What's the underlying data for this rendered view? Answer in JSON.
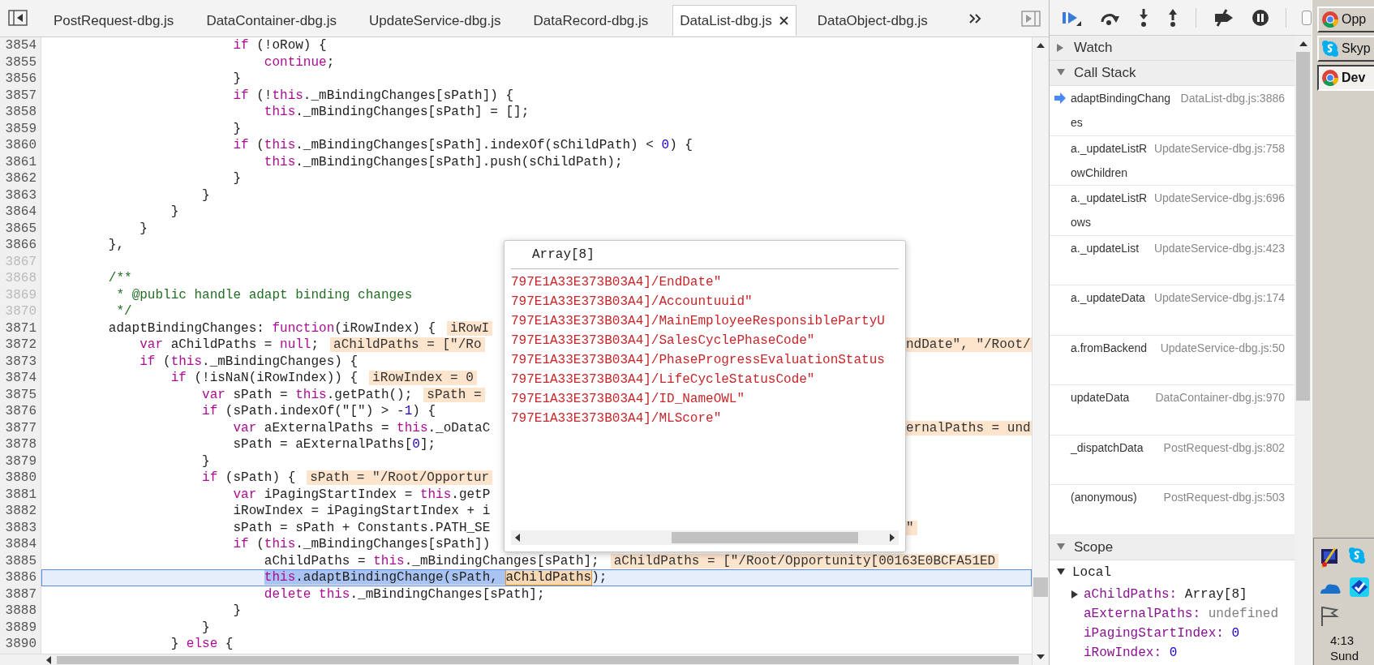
{
  "editor": {
    "tabs": [
      {
        "label": "PostRequest-dbg.js",
        "selected": false
      },
      {
        "label": "DataContainer-dbg.js",
        "selected": false
      },
      {
        "label": "UpdateService-dbg.js",
        "selected": false
      },
      {
        "label": "DataRecord-dbg.js",
        "selected": false
      },
      {
        "label": "DataList-dbg.js",
        "selected": true
      },
      {
        "label": "DataObject-dbg.js",
        "selected": false
      }
    ],
    "lines": [
      {
        "number": "3854",
        "executable": true,
        "current": false,
        "code": [
          {
            "kind": "code",
            "tokens": [
              {
                "kind": "keyword",
                "text": "                        if"
              },
              {
                "kind": "plain",
                "text": " (!oRow) {"
              }
            ]
          }
        ]
      },
      {
        "number": "3855",
        "executable": true,
        "current": false,
        "code": [
          {
            "kind": "code",
            "tokens": [
              {
                "kind": "keyword",
                "text": "                            continue"
              },
              {
                "kind": "plain",
                "text": ";"
              }
            ]
          }
        ]
      },
      {
        "number": "3856",
        "executable": true,
        "current": false,
        "code": [
          {
            "kind": "code",
            "tokens": [
              {
                "kind": "plain",
                "text": "                        }"
              }
            ]
          }
        ]
      },
      {
        "number": "3857",
        "executable": true,
        "current": false,
        "code": [
          {
            "kind": "code",
            "tokens": [
              {
                "kind": "keyword",
                "text": "                        if"
              },
              {
                "kind": "plain",
                "text": " (!"
              },
              {
                "kind": "keyword",
                "text": "this"
              },
              {
                "kind": "plain",
                "text": "._mBindingChanges[sPath]) {"
              }
            ]
          }
        ]
      },
      {
        "number": "3858",
        "executable": true,
        "current": false,
        "code": [
          {
            "kind": "code",
            "tokens": [
              {
                "kind": "keyword",
                "text": "                            this"
              },
              {
                "kind": "plain",
                "text": "._mBindingChanges[sPath] = [];"
              }
            ]
          }
        ]
      },
      {
        "number": "3859",
        "executable": true,
        "current": false,
        "code": [
          {
            "kind": "code",
            "tokens": [
              {
                "kind": "plain",
                "text": "                        }"
              }
            ]
          }
        ]
      },
      {
        "number": "3860",
        "executable": true,
        "current": false,
        "code": [
          {
            "kind": "code",
            "tokens": [
              {
                "kind": "keyword",
                "text": "                        if"
              },
              {
                "kind": "plain",
                "text": " ("
              },
              {
                "kind": "keyword",
                "text": "this"
              },
              {
                "kind": "plain",
                "text": "._mBindingChanges[sPath].indexOf(sChildPath) < "
              },
              {
                "kind": "number",
                "text": "0"
              },
              {
                "kind": "plain",
                "text": ") {"
              }
            ]
          }
        ]
      },
      {
        "number": "3861",
        "executable": true,
        "current": false,
        "code": [
          {
            "kind": "code",
            "tokens": [
              {
                "kind": "keyword",
                "text": "                            this"
              },
              {
                "kind": "plain",
                "text": "._mBindingChanges[sPath].push(sChildPath);"
              }
            ]
          }
        ]
      },
      {
        "number": "3862",
        "executable": true,
        "current": false,
        "code": [
          {
            "kind": "code",
            "tokens": [
              {
                "kind": "plain",
                "text": "                        }"
              }
            ]
          }
        ]
      },
      {
        "number": "3863",
        "executable": true,
        "current": false,
        "code": [
          {
            "kind": "code",
            "tokens": [
              {
                "kind": "plain",
                "text": "                    }"
              }
            ]
          }
        ]
      },
      {
        "number": "3864",
        "executable": true,
        "current": false,
        "code": [
          {
            "kind": "code",
            "tokens": [
              {
                "kind": "plain",
                "text": "                }"
              }
            ]
          }
        ]
      },
      {
        "number": "3865",
        "executable": true,
        "current": false,
        "code": [
          {
            "kind": "code",
            "tokens": [
              {
                "kind": "plain",
                "text": "            }"
              }
            ]
          }
        ]
      },
      {
        "number": "3866",
        "executable": true,
        "current": false,
        "code": [
          {
            "kind": "code",
            "tokens": [
              {
                "kind": "plain",
                "text": "        },"
              }
            ]
          }
        ]
      },
      {
        "number": "3867",
        "executable": false,
        "current": false
      },
      {
        "number": "3868",
        "executable": false,
        "current": false,
        "code": [
          {
            "kind": "code",
            "tokens": [
              {
                "kind": "comment",
                "text": "        /**"
              }
            ]
          }
        ]
      },
      {
        "number": "3869",
        "executable": false,
        "current": false,
        "code": [
          {
            "kind": "code",
            "tokens": [
              {
                "kind": "comment",
                "text": "         * @public handle adapt binding changes"
              }
            ]
          }
        ]
      },
      {
        "number": "3870",
        "executable": false,
        "current": false,
        "code": [
          {
            "kind": "code",
            "tokens": [
              {
                "kind": "comment",
                "text": "         */"
              }
            ]
          }
        ]
      },
      {
        "number": "3871",
        "executable": true,
        "current": false,
        "code": [
          {
            "kind": "code",
            "tokens": [
              {
                "kind": "plain",
                "text": "        adaptBindingChanges: "
              },
              {
                "kind": "keyword",
                "text": "function"
              },
              {
                "kind": "plain",
                "text": "(iRowIndex) {"
              }
            ]
          },
          {
            "kind": "value",
            "text": "iRowI"
          }
        ]
      },
      {
        "number": "3872",
        "executable": true,
        "current": false,
        "code": [
          {
            "kind": "code",
            "tokens": [
              {
                "kind": "keyword",
                "text": "            var"
              },
              {
                "kind": "plain",
                "text": " aChildPaths = "
              },
              {
                "kind": "keyword",
                "text": "null"
              },
              {
                "kind": "plain",
                "text": ";"
              }
            ]
          },
          {
            "kind": "value",
            "text": "aChildPaths = [\"/Ro"
          }
        ],
        "tail": [
          {
            "kind": "value",
            "text": "ndDate\", \"/Root/"
          }
        ]
      },
      {
        "number": "3873",
        "executable": true,
        "current": false,
        "code": [
          {
            "kind": "code",
            "tokens": [
              {
                "kind": "keyword",
                "text": "            if"
              },
              {
                "kind": "plain",
                "text": " ("
              },
              {
                "kind": "keyword",
                "text": "this"
              },
              {
                "kind": "plain",
                "text": "._mBindingChanges) {"
              }
            ]
          }
        ]
      },
      {
        "number": "3874",
        "executable": true,
        "current": false,
        "code": [
          {
            "kind": "code",
            "tokens": [
              {
                "kind": "keyword",
                "text": "                if"
              },
              {
                "kind": "plain",
                "text": " (!isNaN(iRowIndex)) {"
              }
            ]
          },
          {
            "kind": "value",
            "text": "iRowIndex = 0"
          }
        ]
      },
      {
        "number": "3875",
        "executable": true,
        "current": false,
        "code": [
          {
            "kind": "code",
            "tokens": [
              {
                "kind": "keyword",
                "text": "                    var"
              },
              {
                "kind": "plain",
                "text": " sPath = "
              },
              {
                "kind": "keyword",
                "text": "this"
              },
              {
                "kind": "plain",
                "text": ".getPath();"
              }
            ]
          },
          {
            "kind": "value",
            "text": "sPath ="
          }
        ]
      },
      {
        "number": "3876",
        "executable": true,
        "current": false,
        "code": [
          {
            "kind": "code",
            "tokens": [
              {
                "kind": "keyword",
                "text": "                    if"
              },
              {
                "kind": "plain",
                "text": " (sPath.indexOf(\"[\") > -"
              },
              {
                "kind": "number",
                "text": "1"
              },
              {
                "kind": "plain",
                "text": ") {"
              }
            ]
          }
        ]
      },
      {
        "number": "3877",
        "executable": true,
        "current": false,
        "code": [
          {
            "kind": "code",
            "tokens": [
              {
                "kind": "keyword",
                "text": "                        var"
              },
              {
                "kind": "plain",
                "text": " aExternalPaths = "
              },
              {
                "kind": "keyword",
                "text": "this"
              },
              {
                "kind": "plain",
                "text": "._oDataC"
              }
            ]
          }
        ],
        "tail": [
          {
            "kind": "value",
            "text": "ernalPaths = und"
          }
        ]
      },
      {
        "number": "3878",
        "executable": true,
        "current": false,
        "code": [
          {
            "kind": "code",
            "tokens": [
              {
                "kind": "plain",
                "text": "                        sPath = aExternalPaths["
              },
              {
                "kind": "number",
                "text": "0"
              },
              {
                "kind": "plain",
                "text": "];"
              }
            ]
          }
        ]
      },
      {
        "number": "3879",
        "executable": true,
        "current": false,
        "code": [
          {
            "kind": "code",
            "tokens": [
              {
                "kind": "plain",
                "text": "                    }"
              }
            ]
          }
        ]
      },
      {
        "number": "3880",
        "executable": true,
        "current": false,
        "code": [
          {
            "kind": "code",
            "tokens": [
              {
                "kind": "keyword",
                "text": "                    if"
              },
              {
                "kind": "plain",
                "text": " (sPath) {"
              }
            ]
          },
          {
            "kind": "value",
            "text": "sPath = \"/Root/Opportur"
          }
        ]
      },
      {
        "number": "3881",
        "executable": true,
        "current": false,
        "code": [
          {
            "kind": "code",
            "tokens": [
              {
                "kind": "keyword",
                "text": "                        var"
              },
              {
                "kind": "plain",
                "text": " iPagingStartIndex = "
              },
              {
                "kind": "keyword",
                "text": "this"
              },
              {
                "kind": "plain",
                "text": ".getP"
              }
            ]
          }
        ]
      },
      {
        "number": "3882",
        "executable": true,
        "current": false,
        "code": [
          {
            "kind": "code",
            "tokens": [
              {
                "kind": "plain",
                "text": "                        iRowIndex = iPagingStartIndex + i"
              }
            ]
          }
        ]
      },
      {
        "number": "3883",
        "executable": true,
        "current": false,
        "code": [
          {
            "kind": "code",
            "tokens": [
              {
                "kind": "plain",
                "text": "                        sPath = sPath + Constants.PATH_SE"
              }
            ]
          }
        ],
        "tail": [
          {
            "kind": "value",
            "text": "\""
          }
        ]
      },
      {
        "number": "3884",
        "executable": true,
        "current": false,
        "code": [
          {
            "kind": "code",
            "tokens": [
              {
                "kind": "keyword",
                "text": "                        if"
              },
              {
                "kind": "plain",
                "text": " ("
              },
              {
                "kind": "keyword",
                "text": "this"
              },
              {
                "kind": "plain",
                "text": "._mBindingChanges[sPath])"
              }
            ]
          }
        ]
      },
      {
        "number": "3885",
        "executable": true,
        "current": false,
        "code": [
          {
            "kind": "code",
            "tokens": [
              {
                "kind": "plain",
                "text": "                            aChildPaths = "
              },
              {
                "kind": "keyword",
                "text": "this"
              },
              {
                "kind": "plain",
                "text": "._mBindingChanges[sPath];"
              }
            ]
          },
          {
            "kind": "value",
            "text": "aChildPaths = [\"/Root/Opportunity[00163E0BCFA51ED"
          }
        ]
      },
      {
        "number": "3886",
        "executable": true,
        "current": true,
        "code": [
          {
            "kind": "selection",
            "tokens": [
              {
                "kind": "keyword",
                "text": "                            this"
              },
              {
                "kind": "plain",
                "text": ".adaptBindingChange(sPath, "
              }
            ]
          },
          {
            "kind": "hover",
            "text": "aChildPaths"
          },
          {
            "kind": "code",
            "tokens": [
              {
                "kind": "plain",
                "text": ");"
              }
            ]
          }
        ]
      },
      {
        "number": "3887",
        "executable": true,
        "current": false,
        "code": [
          {
            "kind": "code",
            "tokens": [
              {
                "kind": "keyword",
                "text": "                            delete this"
              },
              {
                "kind": "plain",
                "text": "._mBindingChanges[sPath];"
              }
            ]
          }
        ]
      },
      {
        "number": "3888",
        "executable": true,
        "current": false,
        "code": [
          {
            "kind": "code",
            "tokens": [
              {
                "kind": "plain",
                "text": "                        }"
              }
            ]
          }
        ]
      },
      {
        "number": "3889",
        "executable": true,
        "current": false,
        "code": [
          {
            "kind": "code",
            "tokens": [
              {
                "kind": "plain",
                "text": "                    }"
              }
            ]
          }
        ]
      },
      {
        "number": "3890",
        "executable": true,
        "current": false,
        "code": [
          {
            "kind": "code",
            "tokens": [
              {
                "kind": "plain",
                "text": "                } "
              },
              {
                "kind": "keyword",
                "text": "else"
              },
              {
                "kind": "plain",
                "text": " {"
              }
            ]
          }
        ]
      }
    ],
    "popup": {
      "title": "Array[8]",
      "items": [
        "797E1A33E373B03A4]/EndDate\"",
        "797E1A33E373B03A4]/Accountuuid\"",
        "797E1A33E373B03A4]/MainEmployeeResponsiblePartyU",
        "797E1A33E373B03A4]/SalesCyclePhaseCode\"",
        "797E1A33E373B03A4]/PhaseProgressEvaluationStatus",
        "797E1A33E373B03A4]/LifeCycleStatusCode\"",
        "797E1A33E373B03A4]/ID_NameOWL\"",
        "797E1A33E373B03A4]/MLScore\""
      ]
    }
  },
  "debugger": {
    "toolbar": {
      "checkbox": {
        "checked": false
      }
    },
    "watch": {
      "title": "Watch",
      "expanded": false
    },
    "call_stack": {
      "title": "Call Stack",
      "expanded": true,
      "frames": [
        {
          "function": "adaptBindingChanges",
          "location": "DataList-dbg.js:3886",
          "current": true
        },
        {
          "function": "a._updateListRowChildren",
          "location": "UpdateService-dbg.js:758",
          "current": false
        },
        {
          "function": "a._updateListRows",
          "location": "UpdateService-dbg.js:696",
          "current": false
        },
        {
          "function": "a._updateList",
          "location": "UpdateService-dbg.js:423",
          "current": false
        },
        {
          "function": "a._updateData",
          "location": "UpdateService-dbg.js:174",
          "current": false
        },
        {
          "function": "a.fromBackend",
          "location": "UpdateService-dbg.js:50",
          "current": false
        },
        {
          "function": "updateData",
          "location": "DataContainer-dbg.js:970",
          "current": false
        },
        {
          "function": "_dispatchData",
          "location": "PostRequest-dbg.js:802",
          "current": false
        },
        {
          "function": "(anonymous)",
          "location": "PostRequest-dbg.js:503",
          "current": false
        }
      ]
    },
    "scope": {
      "title": "Scope",
      "expanded": true,
      "groups": [
        {
          "title": "Local",
          "expanded": true,
          "variables": [
            {
              "name": "aChildPaths:",
              "value": "Array[8]",
              "kind": "object",
              "expanded": false
            },
            {
              "name": "aExternalPaths:",
              "value": "undefined",
              "kind": "undefined"
            },
            {
              "name": "iPagingStartIndex:",
              "value": "0",
              "kind": "number"
            },
            {
              "name": "iRowIndex:",
              "value": "0",
              "kind": "number"
            }
          ]
        }
      ]
    }
  },
  "taskbar": {
    "buttons": [
      {
        "label": "Opp",
        "kind": "browser",
        "selected": false
      },
      {
        "label": "Skyp",
        "kind": "chat",
        "selected": false
      },
      {
        "label": "Dev",
        "kind": "browser",
        "selected": true
      }
    ],
    "clock": {
      "time": "4:13",
      "day": "Sund"
    }
  }
}
